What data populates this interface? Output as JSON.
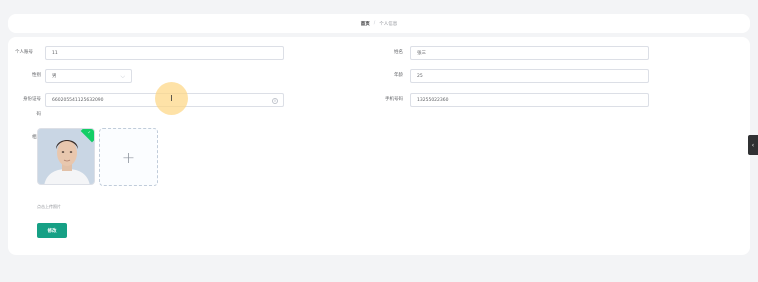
{
  "breadcrumb": {
    "home": "首页",
    "separator": "/",
    "current": "个人信息"
  },
  "form": {
    "account": {
      "label": "个人账号",
      "value": "11"
    },
    "name": {
      "label": "姓名",
      "value": "张三"
    },
    "gender": {
      "label": "性别",
      "value": "男"
    },
    "age": {
      "label": "年龄",
      "value": "25"
    },
    "id_card": {
      "label_line1": "身份证号",
      "label_line2": "码",
      "value": "660205541125632090"
    },
    "phone": {
      "label": "手机号码",
      "value": "13255022360"
    },
    "photo": {
      "label": "相片",
      "hint": "点击上传照片",
      "add_symbol": "+"
    },
    "submit_label": "修改"
  },
  "cursor_glyph": "I",
  "side_tab_glyph": "‹",
  "colors": {
    "primary_button": "#16a085",
    "success_badge": "#13ce66",
    "cursor_highlight": "#fdd682"
  }
}
